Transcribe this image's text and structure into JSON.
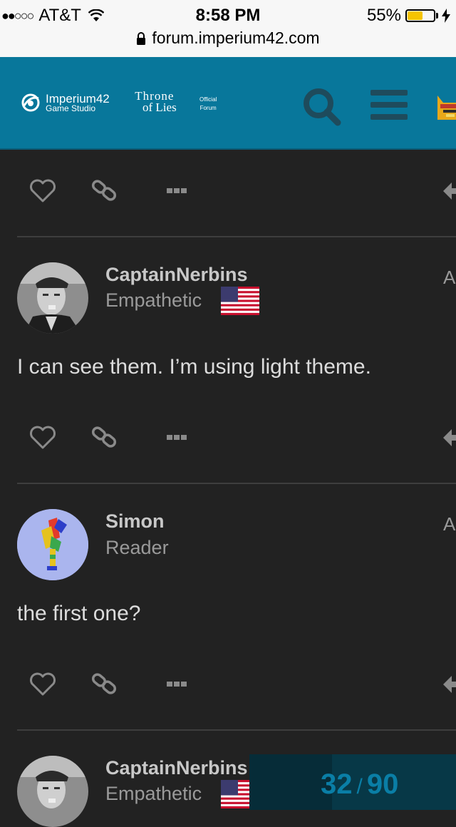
{
  "status_bar": {
    "carrier": "AT&T",
    "signal_dots": "●●○○○",
    "time": "8:58 PM",
    "battery": "55%",
    "url": "forum.imperium42.com"
  },
  "header": {
    "brand1_line1": "Imperium42",
    "brand1_line2": "Game Studio",
    "brand2_line1": "Throne",
    "brand2_line2": "of Lies",
    "brand3_line1": "Official",
    "brand3_line2": "Forum",
    "accent": "#08779b"
  },
  "posts": [
    {
      "username": "CaptainNerbins",
      "title": "Empathetic",
      "date_char": "A",
      "body": "I can see them. I’m using light theme.",
      "flag": "US"
    },
    {
      "username": "Simon",
      "title": "Reader",
      "date_char": "A",
      "body": "the first one?"
    },
    {
      "username": "CaptainNerbins",
      "title": "Empathetic",
      "flag": "US"
    }
  ],
  "progress": {
    "current": "32",
    "separator": "/",
    "total": "90"
  }
}
